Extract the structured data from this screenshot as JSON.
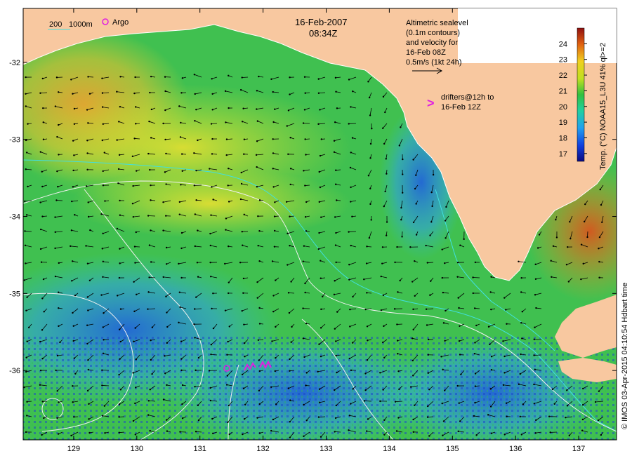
{
  "header": {
    "date": "16-Feb-2007",
    "time": "08:34Z"
  },
  "legend": {
    "contour_depths": "200",
    "contour_depths_2": "1000m",
    "argo_label": "Argo"
  },
  "altimetry_note": {
    "line1": "Altimetric sealevel",
    "line2": "(0.1m contours)",
    "line3": "and velocity for",
    "line4": "16-Feb 08Z",
    "line5": "0.5m/s (1kt 24h)"
  },
  "drifter_note": {
    "symbol": ">",
    "line1": "drifters@12h to",
    "line2": "16-Feb 12Z"
  },
  "colorbar": {
    "title": "Temp. (°C) NOAA15_L3U 41% ql>=2",
    "ticks": [
      "24",
      "23",
      "22",
      "21",
      "20",
      "19",
      "18",
      "17"
    ],
    "min": 16.5,
    "max": 25
  },
  "axes": {
    "x_ticks": [
      "129",
      "130",
      "131",
      "132",
      "133",
      "134",
      "135",
      "136",
      "137"
    ],
    "y_ticks": [
      "-32",
      "-33",
      "-34",
      "-35",
      "-36"
    ],
    "lon_range": [
      128.2,
      137.6
    ],
    "lat_range": [
      -31.3,
      -36.9
    ]
  },
  "credit": "© IMOS 03-Apr-2015 04:10:54 Hdbart time",
  "colors": {
    "land": "#f8c8a0",
    "warm": "#e87a20",
    "mid": "#c8e020",
    "green": "#30c050",
    "cool": "#30a8e0",
    "cold": "#1020c0",
    "argo": "#e020e0",
    "contour_200": "#40e0e0",
    "contour_1000": "#f0f0f0"
  }
}
